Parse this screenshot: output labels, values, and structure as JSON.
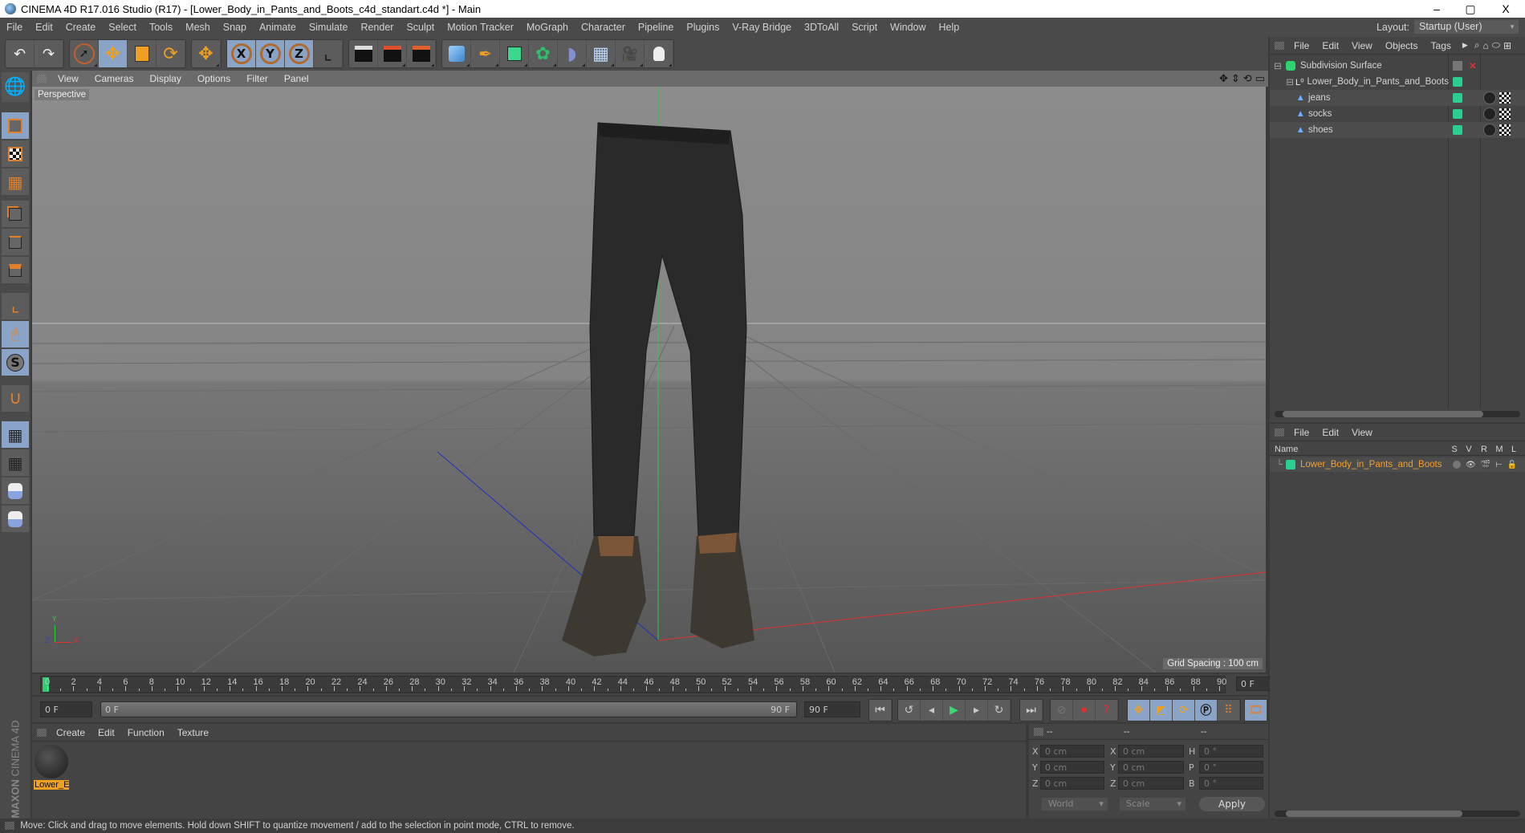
{
  "window": {
    "title": "CINEMA 4D R17.016 Studio (R17) - [Lower_Body_in_Pants_and_Boots_c4d_standart.c4d *] - Main",
    "controls": [
      "–",
      "▢",
      "X"
    ]
  },
  "menubar": {
    "items": [
      "File",
      "Edit",
      "Create",
      "Select",
      "Tools",
      "Mesh",
      "Snap",
      "Animate",
      "Simulate",
      "Render",
      "Sculpt",
      "Motion Tracker",
      "MoGraph",
      "Character",
      "Pipeline",
      "Plugins",
      "V-Ray Bridge",
      "3DToAll",
      "Script",
      "Window",
      "Help"
    ],
    "layout_label": "Layout:",
    "layout_value": "Startup (User)"
  },
  "toolbar": {
    "groups": [
      {
        "name": "history",
        "tools": [
          {
            "id": "undo-icon",
            "glyph": "↶"
          },
          {
            "id": "redo-icon",
            "glyph": "↷"
          }
        ]
      },
      {
        "name": "transform",
        "tools": [
          {
            "id": "select-arrow-icon",
            "glyph": "➚"
          },
          {
            "id": "move-icon",
            "glyph": "✥",
            "on": true
          },
          {
            "id": "scale-icon",
            "glyph": "◩"
          },
          {
            "id": "rotate-icon",
            "glyph": "⟳"
          }
        ]
      },
      {
        "name": "recent",
        "tools": [
          {
            "id": "recent-move-icon",
            "glyph": "✥"
          }
        ]
      },
      {
        "name": "axes",
        "tools": [
          {
            "id": "x-axis-icon",
            "glyph": "X",
            "on": true
          },
          {
            "id": "y-axis-icon",
            "glyph": "Y",
            "on": true
          },
          {
            "id": "z-axis-icon",
            "glyph": "Z",
            "on": true
          },
          {
            "id": "coordinate-system-icon",
            "glyph": "⌞"
          }
        ]
      },
      {
        "name": "render",
        "tools": [
          {
            "id": "render-view-icon",
            "glyph": "🎬"
          },
          {
            "id": "render-picture-viewer-icon",
            "glyph": "🎬"
          },
          {
            "id": "render-settings-icon",
            "glyph": "🎬"
          }
        ]
      },
      {
        "name": "objects",
        "tools": [
          {
            "id": "cube-icon",
            "glyph": "⬢"
          },
          {
            "id": "pen-spline-icon",
            "glyph": "✒"
          },
          {
            "id": "subdivision-icon",
            "glyph": "▣"
          },
          {
            "id": "array-icon",
            "glyph": "✿"
          },
          {
            "id": "deformer-icon",
            "glyph": "◗"
          },
          {
            "id": "floor-icon",
            "glyph": "▦"
          },
          {
            "id": "camera-icon",
            "glyph": "🎥"
          },
          {
            "id": "light-icon",
            "glyph": "💡"
          }
        ]
      }
    ]
  },
  "left_tools": [
    {
      "id": "model-mode-icon",
      "on": true
    },
    {
      "id": "texture-mode-icon"
    },
    {
      "id": "workplane-mode-icon"
    },
    {
      "id": "points-mode-icon"
    },
    {
      "id": "edges-mode-icon"
    },
    {
      "id": "polygons-mode-icon"
    },
    {
      "id": "axis-mode-icon"
    },
    {
      "id": "tweak-mode-icon",
      "on": true
    },
    {
      "id": "snap-icon",
      "on": true
    },
    {
      "id": "magnet-icon"
    },
    {
      "id": "workplane-lock-icon",
      "on": true
    },
    {
      "id": "workplane-align-icon"
    },
    {
      "id": "python-icon"
    },
    {
      "id": "python-script-icon"
    }
  ],
  "viewport": {
    "menu": [
      "View",
      "Cameras",
      "Display",
      "Options",
      "Filter",
      "Panel"
    ],
    "label": "Perspective",
    "grid_spacing": "Grid Spacing : 100 cm",
    "axis_labels": {
      "x": "X",
      "y": "Y",
      "z": "Z"
    }
  },
  "timeline": {
    "start": 0,
    "end": 90,
    "step": 2,
    "current_frame": "0 F",
    "field_start": "0 F",
    "slider_start": "0 F",
    "slider_end": "90 F",
    "field_end": "90 F"
  },
  "material_panel": {
    "menu": [
      "Create",
      "Edit",
      "Function",
      "Texture"
    ],
    "materials": [
      {
        "name": "Lower_E"
      }
    ]
  },
  "coord_panel": {
    "headers": [
      "--",
      "--",
      "--"
    ],
    "rows": [
      {
        "l1": "X",
        "v1": "0 cm",
        "l2": "X",
        "v2": "0 cm",
        "l3": "H",
        "v3": "0 °"
      },
      {
        "l1": "Y",
        "v1": "0 cm",
        "l2": "Y",
        "v2": "0 cm",
        "l3": "P",
        "v3": "0 °"
      },
      {
        "l1": "Z",
        "v1": "0 cm",
        "l2": "Z",
        "v2": "0 cm",
        "l3": "B",
        "v3": "0 °"
      }
    ],
    "mode_dropdown": "World",
    "type_dropdown": "Scale",
    "apply_label": "Apply"
  },
  "object_manager": {
    "menu": [
      "File",
      "Edit",
      "View",
      "Objects",
      "Tags"
    ],
    "objects": [
      {
        "name": "Subdivision Surface",
        "depth": 0,
        "icon": "subdivision-icon"
      },
      {
        "name": "Lower_Body_in_Pants_and_Boots",
        "depth": 1,
        "icon": "null-object-icon"
      },
      {
        "name": "jeans",
        "depth": 2,
        "icon": "polygon-object-icon"
      },
      {
        "name": "socks",
        "depth": 2,
        "icon": "polygon-object-icon"
      },
      {
        "name": "shoes",
        "depth": 2,
        "icon": "polygon-object-icon"
      }
    ]
  },
  "layer_manager": {
    "menu": [
      "File",
      "Edit",
      "View"
    ],
    "columns": [
      "Name",
      "S",
      "V",
      "R",
      "M",
      "L"
    ],
    "layers": [
      {
        "name": "Lower_Body_in_Pants_and_Boots",
        "color": "#2ad08f"
      }
    ]
  },
  "status": {
    "text": "Move: Click and drag to move elements. Hold down SHIFT to quantize movement / add to the selection in point mode, CTRL to remove."
  },
  "branding": {
    "maxon": "MAXON",
    "product": "CINEMA 4D"
  },
  "colors": {
    "accent": "#8aa4c8",
    "layer_green": "#2ad08f",
    "selection_orange": "#f0a020",
    "layer_text": "#f0a030"
  }
}
